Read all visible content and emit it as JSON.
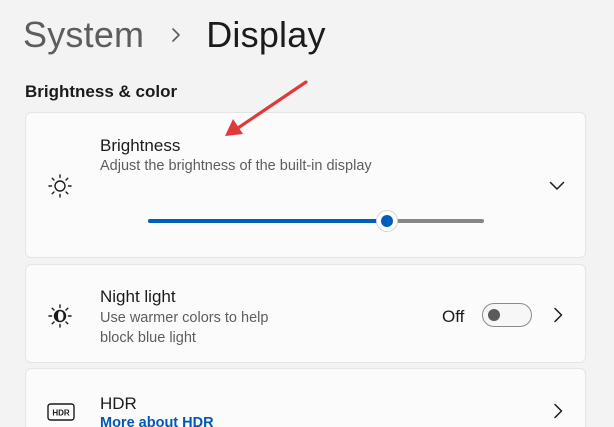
{
  "breadcrumb": {
    "parent": "System",
    "current": "Display"
  },
  "section": {
    "title": "Brightness & color"
  },
  "brightness": {
    "title": "Brightness",
    "description": "Adjust the brightness of the built-in display",
    "level": 0.71,
    "icon": "sun-icon"
  },
  "night_light": {
    "title": "Night light",
    "description_line1": "Use warmer colors to help",
    "description_line2": "block blue light",
    "status": "Off",
    "icon": "night-light-icon"
  },
  "hdr": {
    "title": "HDR",
    "link": "More about HDR",
    "icon": "hdr-icon"
  },
  "colors": {
    "accent": "#005fb8",
    "annotation_arrow": "#e0393a",
    "background": "#f3f3f3",
    "card": "#fbfbfb"
  }
}
